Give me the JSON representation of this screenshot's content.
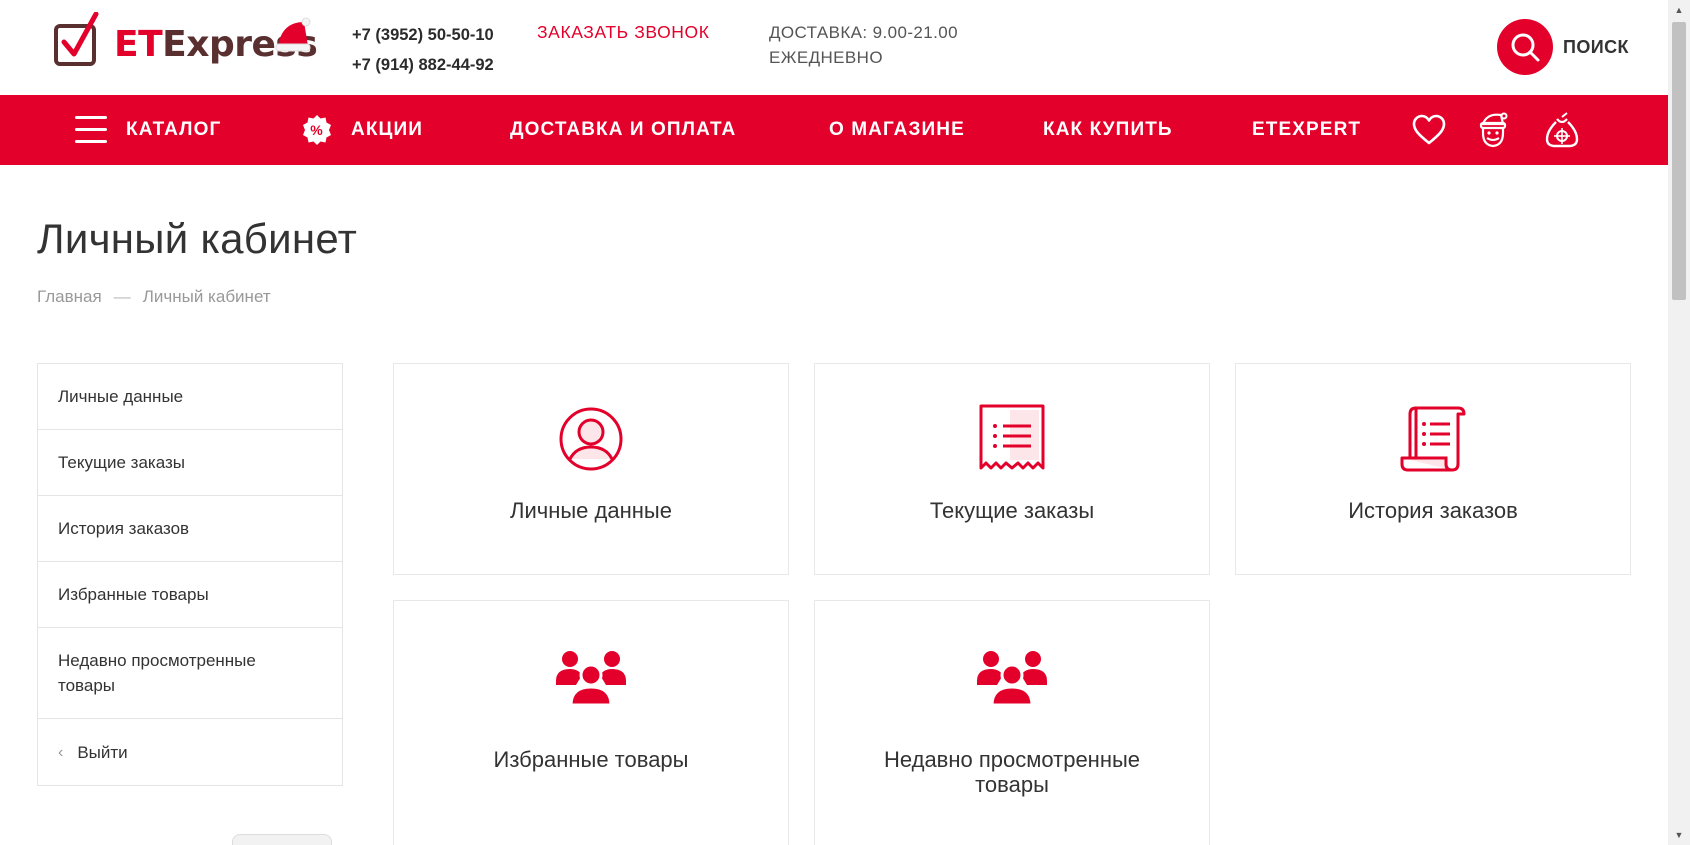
{
  "header": {
    "logo": {
      "part1": "ET",
      "part2": "Express"
    },
    "phones": [
      "+7 (3952) 50-50-10",
      "+7 (914) 882-44-92"
    ],
    "callback_label": "ЗАКАЗАТЬ ЗВОНОК",
    "delivery_line1": "ДОСТАВКА: 9.00-21.00",
    "delivery_line2": "ЕЖЕДНЕВНО",
    "search_label": "ПОИСК",
    "search_icon": "search-icon"
  },
  "nav": {
    "items": [
      {
        "label": "КАТАЛОГ",
        "icon": "hamburger-icon"
      },
      {
        "label": "АКЦИИ",
        "icon": "percent-badge-icon"
      },
      {
        "label": "ДОСТАВКА И ОПЛАТА"
      },
      {
        "label": "О МАГАЗИНЕ"
      },
      {
        "label": "КАК КУПИТЬ"
      },
      {
        "label": "ETEXPERT"
      }
    ],
    "icons": [
      "heart-icon",
      "santa-user-icon",
      "gift-bag-icon"
    ]
  },
  "page": {
    "title": "Личный кабинет",
    "breadcrumb": [
      "Главная",
      "Личный кабинет"
    ]
  },
  "sidebar": {
    "items": [
      {
        "label": "Личные данные"
      },
      {
        "label": "Текущие заказы"
      },
      {
        "label": "История заказов"
      },
      {
        "label": "Избранные товары"
      },
      {
        "label": "Недавно просмотренные товары"
      },
      {
        "label": "Выйти"
      }
    ]
  },
  "cards": [
    {
      "label": "Личные данные",
      "icon": "user-circle-icon"
    },
    {
      "label": "Текущие заказы",
      "icon": "receipt-icon"
    },
    {
      "label": "История заказов",
      "icon": "scroll-list-icon"
    },
    {
      "label": "Избранные товары",
      "icon": "users-group-icon"
    },
    {
      "label": "Недавно просмотренные товары",
      "icon": "users-group-icon"
    }
  ],
  "colors": {
    "accent": "#e3002b",
    "text": "#333333",
    "muted": "#999999",
    "border": "#e5e5e5"
  }
}
